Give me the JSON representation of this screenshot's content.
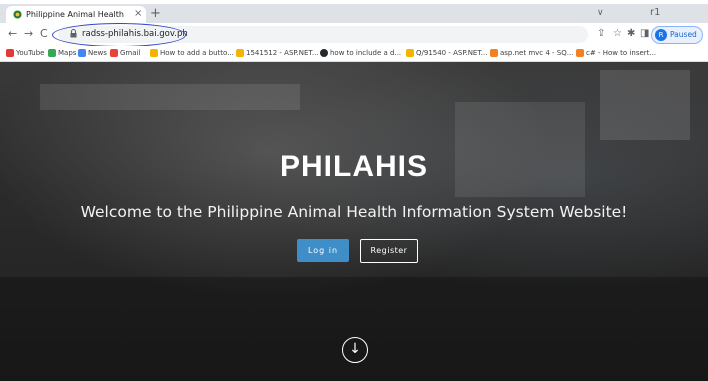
{
  "browser": {
    "tab": {
      "title": "Philippine Animal Health Infor...",
      "close": "×"
    },
    "new_tab": "+",
    "tab_dropdown": "∨",
    "window_min": "r1",
    "nav": {
      "back": "←",
      "forward": "→",
      "reload": "C"
    },
    "url": "radss-philahis.bai.gov.ph",
    "toolbar_icons": {
      "share": "⇪",
      "star": "☆",
      "extensions": "✱",
      "sidepanel": "◨"
    },
    "profile": {
      "initial": "R",
      "label": "Paused"
    },
    "bookmarks": [
      {
        "label": "YouTube",
        "color": "#e53935"
      },
      {
        "label": "Maps",
        "color": "#34a853"
      },
      {
        "label": "News",
        "color": "#4285f4"
      },
      {
        "label": "Gmail",
        "color": "#ea4335"
      },
      {
        "label": "How to add a butto...",
        "color": "#f4b400"
      },
      {
        "label": "1541512 - ASP.NET...",
        "color": "#f4b400"
      },
      {
        "label": "how to include a d...",
        "color": "#24292e"
      },
      {
        "label": "Q/91540 - ASP.NET...",
        "color": "#f4b400"
      },
      {
        "label": "asp.net mvc 4 - SQ...",
        "color": "#f48024"
      },
      {
        "label": "c# - How to insert...",
        "color": "#f48024"
      }
    ]
  },
  "hero": {
    "title": "PHILAHIS",
    "subtitle": "Welcome to the Philippine Animal Health Information System Website!",
    "login_label": "Log in",
    "register_label": "Register",
    "scroll_down": "↓"
  },
  "colors": {
    "login_button": "#3f8ec7",
    "highlight_ring": "#3246c8"
  }
}
